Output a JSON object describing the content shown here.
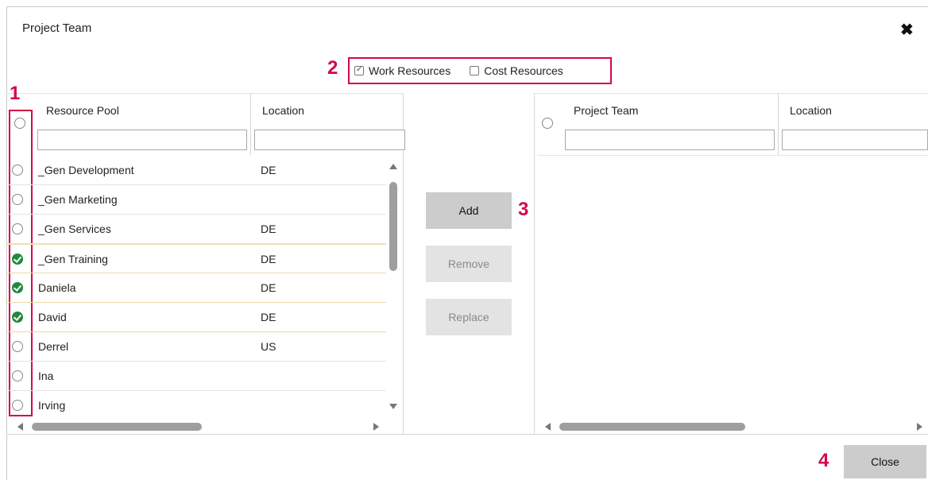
{
  "dialog": {
    "title": "Project Team",
    "close_icon": "close-icon"
  },
  "callouts": {
    "c1": "1",
    "c2": "2",
    "c3": "3",
    "c4": "4"
  },
  "filters": {
    "work_resources": {
      "label": "Work Resources",
      "checked": true
    },
    "cost_resources": {
      "label": "Cost Resources",
      "checked": false
    }
  },
  "resource_pool": {
    "headers": {
      "name": "Resource Pool",
      "location": "Location"
    },
    "rows": [
      {
        "name": "_Gen Development",
        "location": "DE",
        "selected": false
      },
      {
        "name": "_Gen Marketing",
        "location": "",
        "selected": false
      },
      {
        "name": "_Gen Services",
        "location": "DE",
        "selected": false
      },
      {
        "name": "_Gen Training",
        "location": "DE",
        "selected": true
      },
      {
        "name": "Daniela",
        "location": "DE",
        "selected": true
      },
      {
        "name": "David",
        "location": "DE",
        "selected": true
      },
      {
        "name": "Derrel",
        "location": "US",
        "selected": false
      },
      {
        "name": "Ina",
        "location": "",
        "selected": false
      },
      {
        "name": "Irving",
        "location": "",
        "selected": false
      }
    ]
  },
  "project_team": {
    "headers": {
      "name": "Project Team",
      "location": "Location"
    },
    "rows": []
  },
  "actions": {
    "add": "Add",
    "remove": "Remove",
    "replace": "Replace",
    "close": "Close"
  },
  "colors": {
    "accent": "#d10a4a",
    "selected_check": "#1f8a3b"
  }
}
